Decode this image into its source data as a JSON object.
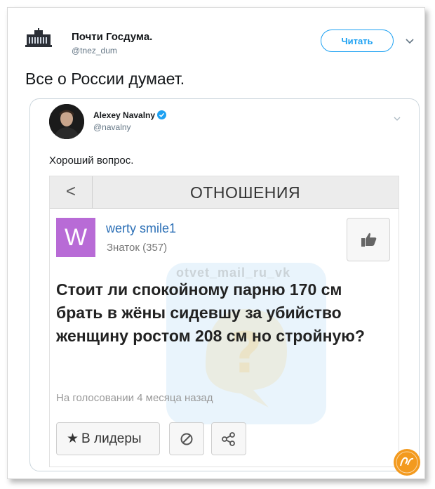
{
  "tweet": {
    "author_name": "Почти Госдума.",
    "author_handle": "@tnez_dum",
    "follow_label": "Читать",
    "text": "Все о России думает."
  },
  "quoted_tweet": {
    "author_name": "Alexey Navalny",
    "author_handle": "@navalny",
    "text": "Хороший вопрос."
  },
  "screenshot": {
    "header_title": "ОТНОШЕНИЯ",
    "back_icon": "<",
    "user": {
      "avatar_letter": "W",
      "name": "werty smile1",
      "rank": "Знаток (357)"
    },
    "question": "Стоит ли спокойному парню 170 см брать в жёны сидевшу за убийство женщину ростом 208 см но стройную?",
    "meta": "На голосовании 4 месяца назад",
    "watermark": "otvet_mail_ru_vk",
    "buttons": {
      "leaders_label": "В лидеры",
      "star_glyph": "★"
    }
  },
  "colors": {
    "accent": "#1da1f2",
    "link": "#2b6fb6",
    "avatar_bg": "#b86bd6",
    "site_logo": "#f39a1e"
  }
}
